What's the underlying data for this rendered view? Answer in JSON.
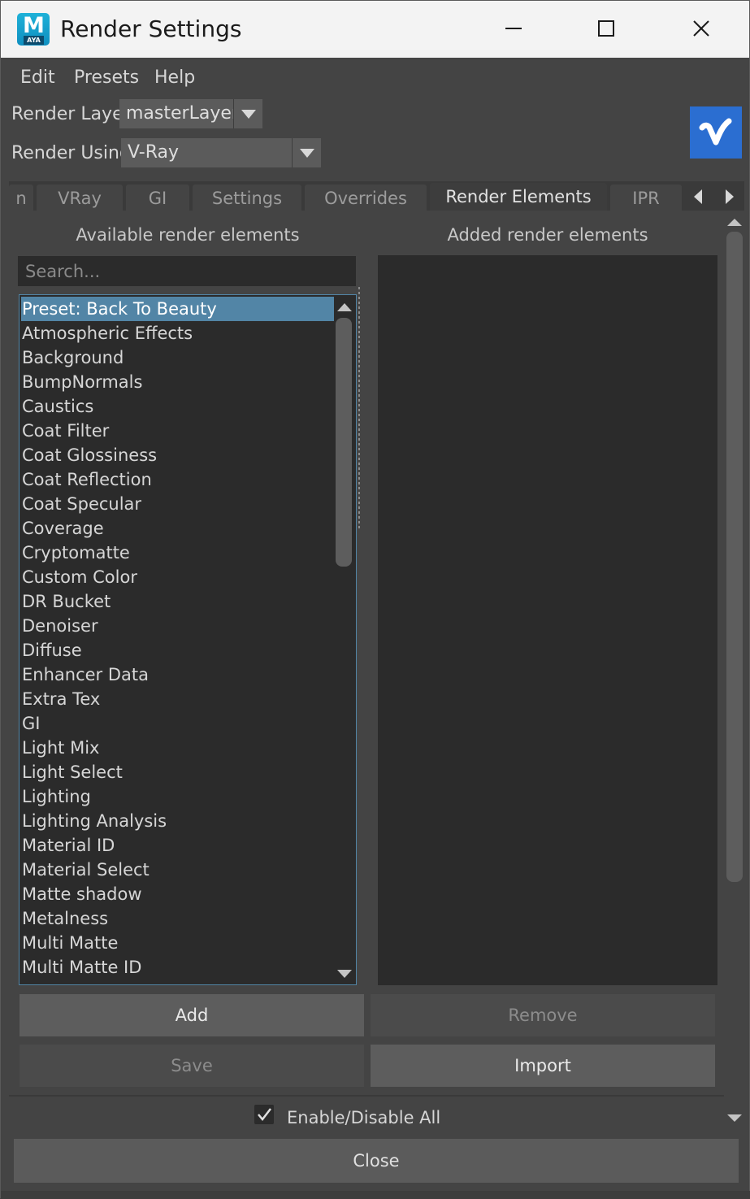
{
  "window": {
    "title": "Render Settings",
    "app_logo_letter": "M",
    "app_logo_sub": "AYA"
  },
  "menu": [
    "Edit",
    "Presets",
    "Help"
  ],
  "render_layer": {
    "label": "Render Layer",
    "value": "masterLayer"
  },
  "render_using": {
    "label": "Render Using",
    "value": "V-Ray"
  },
  "tabs": [
    {
      "label": "n"
    },
    {
      "label": "VRay"
    },
    {
      "label": "GI"
    },
    {
      "label": "Settings"
    },
    {
      "label": "Overrides"
    },
    {
      "label": "Render Elements"
    },
    {
      "label": "IPR"
    }
  ],
  "active_tab": "Render Elements",
  "available": {
    "title": "Available render elements",
    "search_placeholder": "Search...",
    "items": [
      "Preset: Back To Beauty",
      "Atmospheric Effects",
      "Background",
      "BumpNormals",
      "Caustics",
      "Coat Filter",
      "Coat Glossiness",
      "Coat Reflection",
      "Coat Specular",
      "Coverage",
      "Cryptomatte",
      "Custom Color",
      "DR Bucket",
      "Denoiser",
      "Diffuse",
      "Enhancer Data",
      "Extra Tex",
      "GI",
      "Light Mix",
      "Light Select",
      "Lighting",
      "Lighting Analysis",
      "Material ID",
      "Material Select",
      "Matte shadow",
      "Metalness",
      "Multi Matte",
      "Multi Matte ID"
    ],
    "selected": "Preset: Back To Beauty"
  },
  "added": {
    "title": "Added render elements",
    "items": []
  },
  "buttons": {
    "add": "Add",
    "remove": "Remove",
    "save": "Save",
    "import": "Import",
    "close": "Close"
  },
  "enable_all": {
    "label": "Enable/Disable All",
    "checked": true
  },
  "colors": {
    "background": "#444444",
    "list_bg": "#2b2b2b",
    "selection": "#5285a6",
    "vray_blue": "#2b6ed1"
  }
}
